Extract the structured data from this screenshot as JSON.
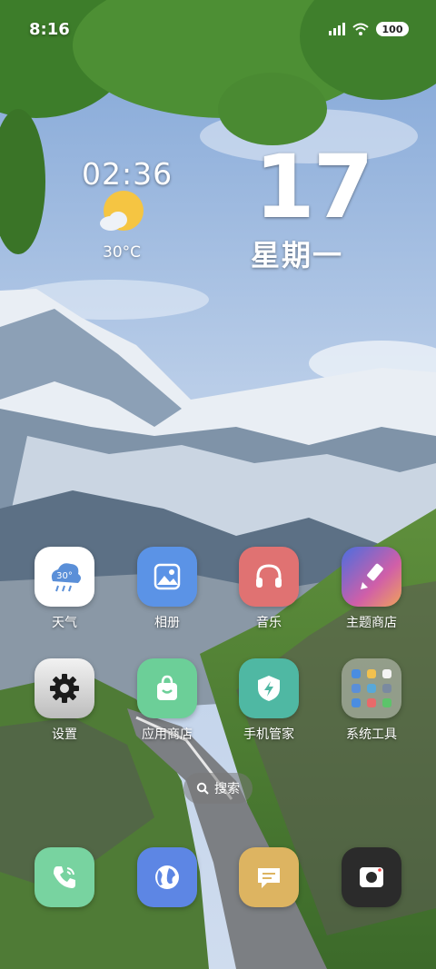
{
  "status_bar": {
    "time": "8:16",
    "battery": "100"
  },
  "clock_widget": {
    "time": "02:36",
    "temperature": "30°C",
    "weather_icon": "sunny-cloud-icon"
  },
  "date_widget": {
    "day": "17",
    "weekday": "星期一"
  },
  "apps_row1": [
    {
      "label": "天气",
      "icon": "weather-icon"
    },
    {
      "label": "相册",
      "icon": "gallery-icon"
    },
    {
      "label": "音乐",
      "icon": "headphones-icon"
    },
    {
      "label": "主题商店",
      "icon": "paintbrush-icon"
    }
  ],
  "apps_row2": [
    {
      "label": "设置",
      "icon": "gear-icon"
    },
    {
      "label": "应用商店",
      "icon": "shopping-bag-icon"
    },
    {
      "label": "手机管家",
      "icon": "shield-icon"
    },
    {
      "label": "系统工具",
      "icon": "folder-icon"
    }
  ],
  "search": {
    "label": "搜索"
  },
  "dock": [
    {
      "icon": "phone-icon"
    },
    {
      "icon": "browser-icon"
    },
    {
      "icon": "message-icon"
    },
    {
      "icon": "camera-icon"
    }
  ],
  "colors": {
    "weather_bg": "#ffffff",
    "gallery_bg": "#5b93e6",
    "music_bg": "#e07272",
    "settings_bg": "#d9d9d9",
    "store_bg": "#6ccf98",
    "manager_bg": "#4fb8a3",
    "phone_bg": "#78d3a0",
    "browser_bg": "#5d86e4",
    "message_bg": "#ddb461",
    "camera_bg": "#2b2b2b"
  }
}
